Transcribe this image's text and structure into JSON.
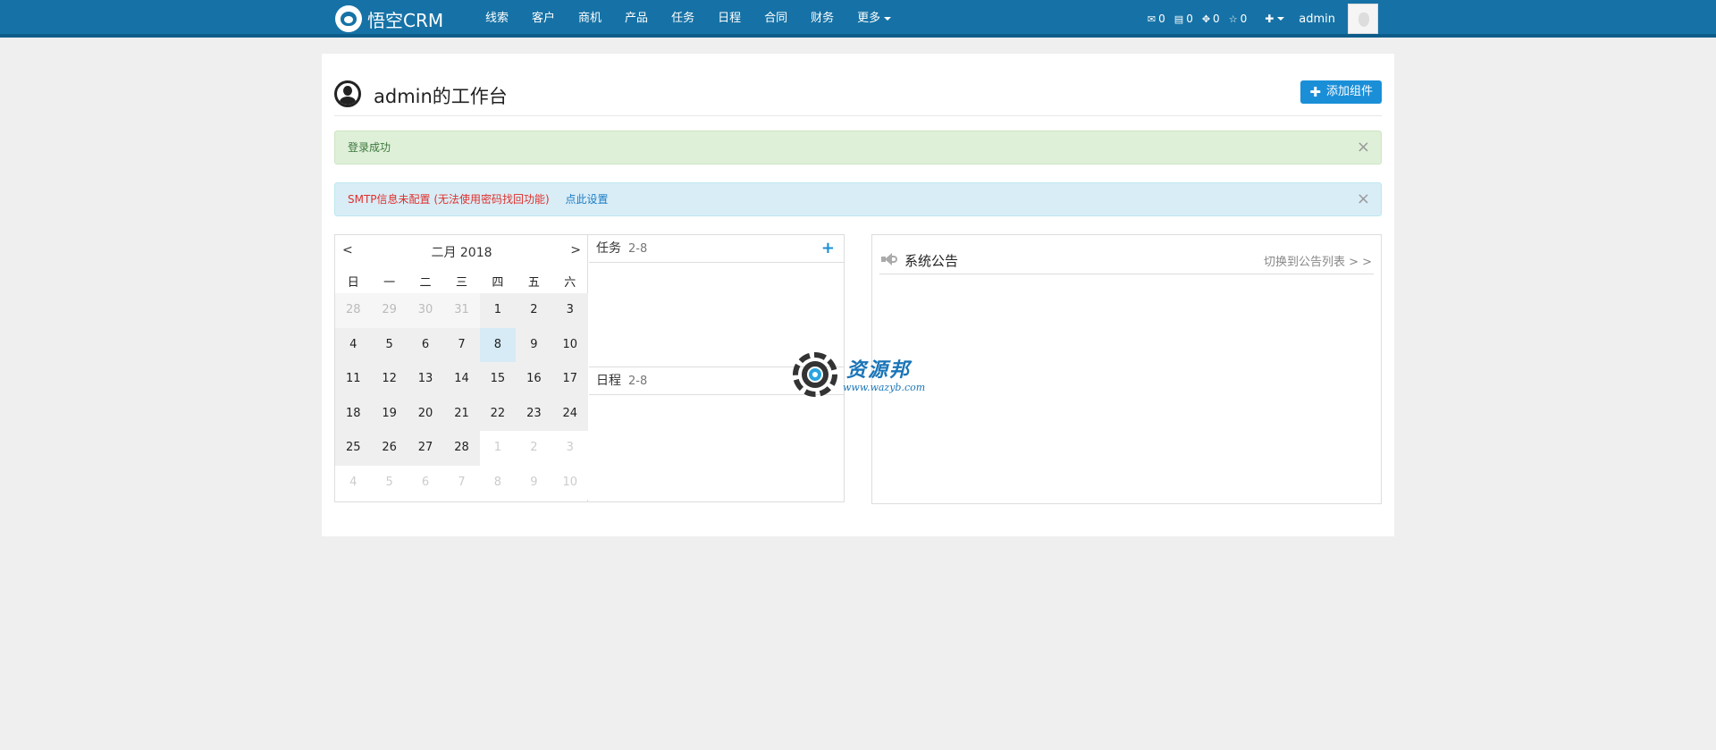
{
  "navbar": {
    "brand": "悟空CRM",
    "items": [
      {
        "label": "线索"
      },
      {
        "label": "客户"
      },
      {
        "label": "商机"
      },
      {
        "label": "产品"
      },
      {
        "label": "任务"
      },
      {
        "label": "日程"
      },
      {
        "label": "合同"
      },
      {
        "label": "财务"
      },
      {
        "label": "更多"
      }
    ],
    "counters": [
      {
        "icon": "envelope-icon",
        "count": "0"
      },
      {
        "icon": "list-icon",
        "count": "0"
      },
      {
        "icon": "move-icon",
        "count": "0"
      },
      {
        "icon": "star-icon",
        "count": "0"
      }
    ],
    "username": "admin"
  },
  "header": {
    "title": "admin的工作台",
    "add_widget_label": "添加组件"
  },
  "alerts": {
    "success_text": "登录成功",
    "info_error_text": "SMTP信息未配置 (无法使用密码找回功能)",
    "info_link_text": "点此设置",
    "close_glyph": "×"
  },
  "calendar": {
    "title": "二月 2018",
    "prev": "<",
    "next": ">",
    "weekdays": [
      "日",
      "一",
      "二",
      "三",
      "四",
      "五",
      "六"
    ],
    "today": "8",
    "days": [
      {
        "d": "28",
        "s": "muted"
      },
      {
        "d": "29",
        "s": "muted"
      },
      {
        "d": "30",
        "s": "muted"
      },
      {
        "d": "31",
        "s": "muted"
      },
      {
        "d": "1",
        "s": ""
      },
      {
        "d": "2",
        "s": ""
      },
      {
        "d": "3",
        "s": ""
      },
      {
        "d": "4",
        "s": ""
      },
      {
        "d": "5",
        "s": ""
      },
      {
        "d": "6",
        "s": ""
      },
      {
        "d": "7",
        "s": ""
      },
      {
        "d": "8",
        "s": "today"
      },
      {
        "d": "9",
        "s": ""
      },
      {
        "d": "10",
        "s": ""
      },
      {
        "d": "11",
        "s": ""
      },
      {
        "d": "12",
        "s": ""
      },
      {
        "d": "13",
        "s": ""
      },
      {
        "d": "14",
        "s": ""
      },
      {
        "d": "15",
        "s": ""
      },
      {
        "d": "16",
        "s": ""
      },
      {
        "d": "17",
        "s": ""
      },
      {
        "d": "18",
        "s": ""
      },
      {
        "d": "19",
        "s": ""
      },
      {
        "d": "20",
        "s": ""
      },
      {
        "d": "21",
        "s": ""
      },
      {
        "d": "22",
        "s": ""
      },
      {
        "d": "23",
        "s": ""
      },
      {
        "d": "24",
        "s": ""
      },
      {
        "d": "25",
        "s": ""
      },
      {
        "d": "26",
        "s": ""
      },
      {
        "d": "27",
        "s": ""
      },
      {
        "d": "28",
        "s": ""
      },
      {
        "d": "1",
        "s": "other"
      },
      {
        "d": "2",
        "s": "other"
      },
      {
        "d": "3",
        "s": "other"
      },
      {
        "d": "4",
        "s": "other"
      },
      {
        "d": "5",
        "s": "other"
      },
      {
        "d": "6",
        "s": "other"
      },
      {
        "d": "7",
        "s": "other"
      },
      {
        "d": "8",
        "s": "other"
      },
      {
        "d": "9",
        "s": "other"
      },
      {
        "d": "10",
        "s": "other"
      }
    ]
  },
  "tasks": {
    "label": "任务",
    "date": "2-8",
    "add_glyph": "+"
  },
  "schedule": {
    "label": "日程",
    "date": "2-8"
  },
  "announcement": {
    "title": "系统公告",
    "switch_link": "切换到公告列表 > >"
  },
  "watermark": {
    "cn": "资源邦",
    "url": "www.wazyb.com"
  },
  "colors": {
    "navbar": "#1672a6",
    "primary": "#1a8fd8",
    "success_bg": "#dff0d8",
    "info_bg": "#d9edf7",
    "error_text": "#e0302c"
  }
}
